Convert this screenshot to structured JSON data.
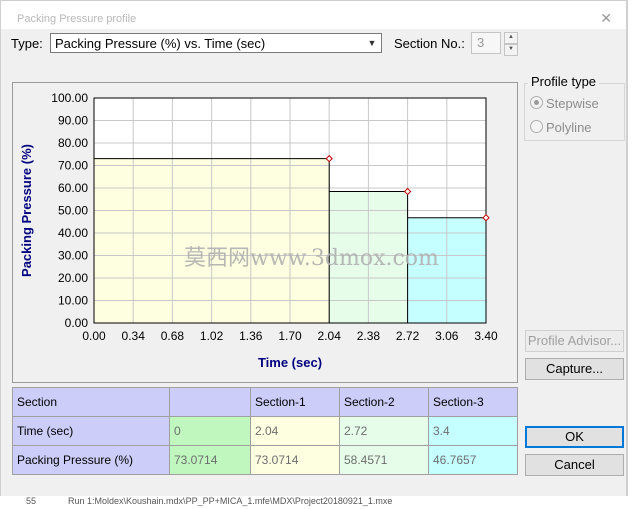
{
  "window": {
    "title": "Packing Pressure profile",
    "close_icon": "close-icon"
  },
  "type_label": "Type:",
  "type_value": "Packing Pressure (%) vs. Time (sec)",
  "section_no_label": "Section No.:",
  "section_no_value": "3",
  "profile_type": {
    "label": "Profile type",
    "options": [
      "Stepwise",
      "Polyline"
    ],
    "selected": "Stepwise"
  },
  "buttons": {
    "profile_advisor": "Profile Advisor...",
    "capture": "Capture...",
    "ok": "OK",
    "cancel": "Cancel"
  },
  "table": {
    "headers": [
      "Section",
      "",
      "Section-1",
      "Section-2",
      "Section-3"
    ],
    "rows": [
      {
        "label": "Time (sec)",
        "values": [
          "0",
          "2.04",
          "2.72",
          "3.4"
        ]
      },
      {
        "label": "Packing Pressure (%)",
        "values": [
          "73.0714",
          "73.0714",
          "58.4571",
          "46.7657"
        ]
      }
    ]
  },
  "watermark": "莫西网www.3dmox.com",
  "status_text": "Run 1:Moldex\\Koushain.mdx\\PP_PP+MICA_1.mfe\\MDX\\Project20180921_1.mxe",
  "status_prefix": "55",
  "colors": {
    "sec1": "#fefee0",
    "sec2": "#e6fdea",
    "sec3": "#c6ffff",
    "header": "#cccdf9",
    "axis_label": "#000080"
  },
  "chart_data": {
    "type": "area",
    "title": "",
    "xlabel": "Time (sec)",
    "ylabel": "Packing Pressure (%)",
    "xlim": [
      0,
      3.4
    ],
    "ylim": [
      0,
      100
    ],
    "xticks": [
      "0.00",
      "0.34",
      "0.68",
      "1.02",
      "1.36",
      "1.70",
      "2.04",
      "2.38",
      "2.72",
      "3.06",
      "3.40"
    ],
    "yticks": [
      "0.00",
      "10.00",
      "20.00",
      "30.00",
      "40.00",
      "50.00",
      "60.00",
      "70.00",
      "80.00",
      "90.00",
      "100.00"
    ],
    "grid": true,
    "series": [
      {
        "x0": 0,
        "x1": 2.04,
        "y": 73.0714
      },
      {
        "x0": 2.04,
        "x1": 2.72,
        "y": 58.4571
      },
      {
        "x0": 2.72,
        "x1": 3.4,
        "y": 46.7657
      }
    ]
  }
}
